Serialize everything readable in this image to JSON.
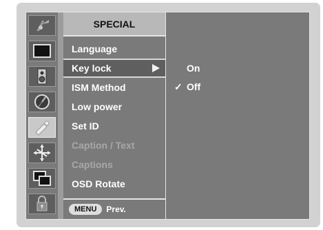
{
  "menu": {
    "title": "SPECIAL",
    "items": [
      {
        "label": "Language",
        "state": "normal"
      },
      {
        "label": "Key lock",
        "state": "highlighted"
      },
      {
        "label": "ISM Method",
        "state": "normal"
      },
      {
        "label": "Low power",
        "state": "normal"
      },
      {
        "label": "Set ID",
        "state": "normal"
      },
      {
        "label": "Caption / Text",
        "state": "disabled"
      },
      {
        "label": "Captions",
        "state": "disabled"
      },
      {
        "label": "OSD Rotate",
        "state": "normal"
      }
    ],
    "footer": {
      "button_label": "MENU",
      "action_label": "Prev."
    }
  },
  "submenu": {
    "options": [
      {
        "label": "On",
        "checked": false,
        "check_mark": ""
      },
      {
        "label": "Off",
        "checked": true,
        "check_mark": "✓"
      }
    ]
  },
  "icons": [
    {
      "name": "picture-adjust-icon",
      "selected": false
    },
    {
      "name": "screen-icon",
      "selected": false
    },
    {
      "name": "speaker-icon",
      "selected": false
    },
    {
      "name": "timer-icon",
      "selected": false
    },
    {
      "name": "special-tool-icon",
      "selected": true
    },
    {
      "name": "arrows-move-icon",
      "selected": false
    },
    {
      "name": "pip-icon",
      "selected": false
    },
    {
      "name": "lock-icon",
      "selected": false
    }
  ],
  "colors": {
    "panel": "#7a7a7a",
    "highlight": "#5f5f5f",
    "text": "#ffffff",
    "disabled_text": "#a8a8a8"
  }
}
